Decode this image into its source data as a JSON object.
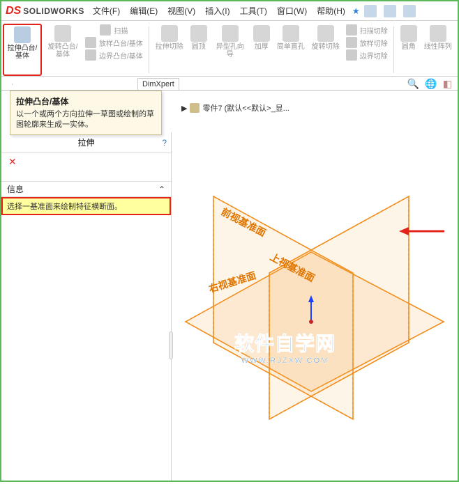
{
  "app": {
    "logo_text": "SOLIDWORKS"
  },
  "menu": {
    "items": [
      "文件(F)",
      "编辑(E)",
      "视图(V)",
      "插入(I)",
      "工具(T)",
      "窗口(W)",
      "帮助(H)"
    ],
    "star": "★"
  },
  "ribbon": {
    "extrude": "拉伸凸台/基体",
    "revolve": "旋转凸台/基体",
    "sweep": "扫描",
    "loft": "放样凸台/基体",
    "boundary": "边界凸台/基体",
    "extrudeCut": "拉伸切除",
    "dome": "圆顶",
    "holeWizard": "异型孔向导",
    "thicken": "加厚",
    "simpleHole": "简单直孔",
    "revCut": "旋转切除",
    "sweepCut": "扫描切除",
    "loftCut": "放样切除",
    "boundaryCut": "边界切除",
    "fillet": "圆角",
    "linearPattern": "线性阵列"
  },
  "tabs": {
    "dimxpert": "DimXpert"
  },
  "tooltip": {
    "title": "拉伸凸台/基体",
    "body": "以一个或两个方向拉伸一草图或绘制的草图轮廓来生成一实体。"
  },
  "leftpanel": {
    "title": "拉伸",
    "help": "?",
    "close": "✕",
    "section": "信息",
    "caret": "⌃",
    "message": "选择一基准面来绘制特征横断面。"
  },
  "breadcrumb": {
    "arrow": "▶",
    "part": "零件7  (默认<<默认>_显..."
  },
  "planes": {
    "front": "前视基准面",
    "top": "上视基准面",
    "right": "右视基准面"
  },
  "watermark": {
    "cn": "软件自学网",
    "en": "WWW.RJZXW.COM"
  }
}
